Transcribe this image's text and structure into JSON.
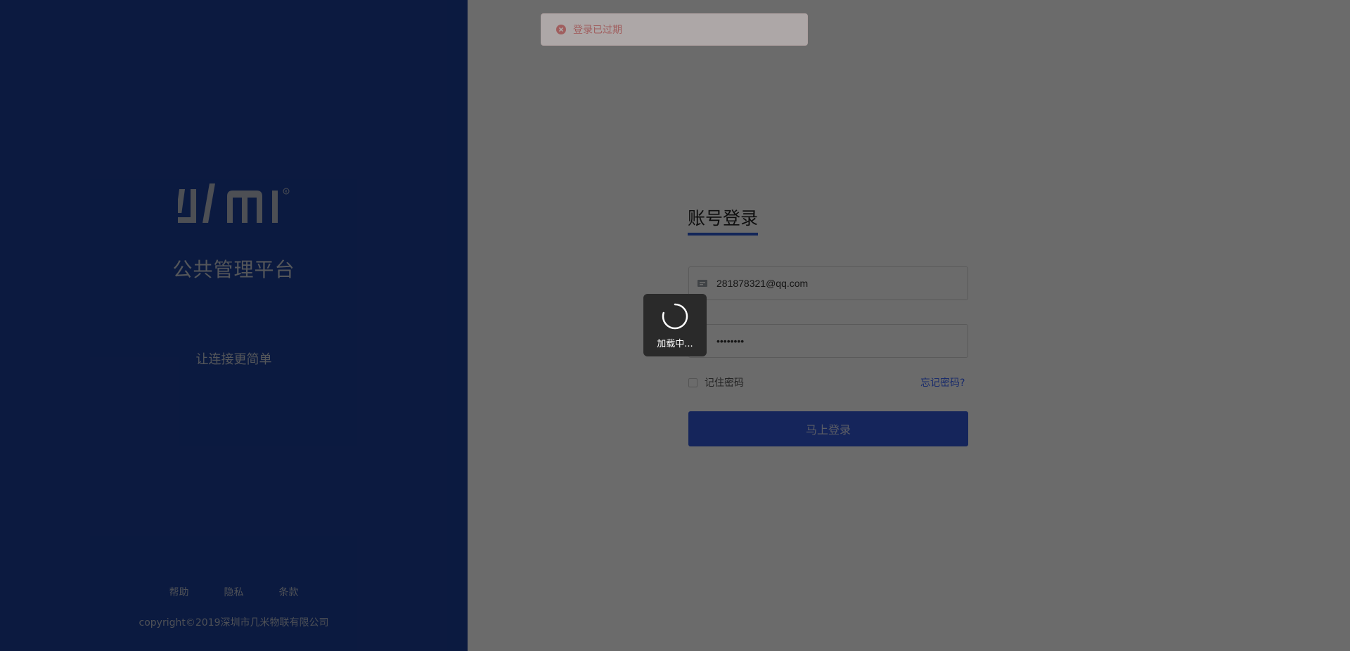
{
  "brand": {
    "logo_text": "Jimi",
    "platform_title": "公共管理平台",
    "slogan": "让连接更简单",
    "footer_links": [
      "帮助",
      "隐私",
      "条款"
    ],
    "copyright": "copyright©2019深圳市几米物联有限公司"
  },
  "alert": {
    "message": "登录已过期",
    "icon": "error-circle-icon",
    "color": "#e04f4f"
  },
  "login": {
    "heading": "账号登录",
    "account_value": "281878321@qq.com",
    "account_icon": "user-card-icon",
    "password_value": "••••••••",
    "password_icon": "lock-icon",
    "remember_label": "记住密码",
    "remember_checked": false,
    "forgot_label": "忘记密码?",
    "submit_label": "马上登录"
  },
  "loading": {
    "text": "加载中..."
  },
  "colors": {
    "brand_blue": "#1c3f98",
    "button_blue": "#3258d8",
    "link_blue": "#3d68ff"
  }
}
